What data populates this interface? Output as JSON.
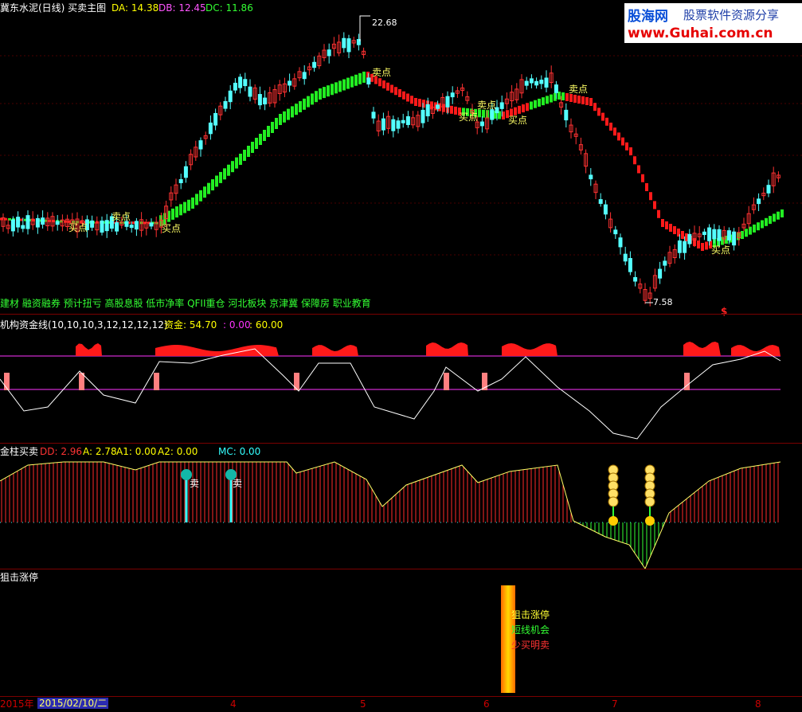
{
  "header": {
    "title": "冀东水泥(日线) 买卖主图",
    "da": "DA: 14.38",
    "db": "DB: 12.45",
    "dc": "DC: 11.86"
  },
  "logo": {
    "cn": "股海网",
    "sub": "股票软件资源分享",
    "url": "www.Guhai.com.cn"
  },
  "main_chart": {
    "high_label": "22.68",
    "low_label": "7.58",
    "signals": [
      {
        "id": "s1",
        "text": "买点"
      },
      {
        "id": "s2",
        "text": "卖点"
      },
      {
        "id": "s3",
        "text": "买点"
      },
      {
        "id": "s4",
        "text": "卖点"
      },
      {
        "id": "s5",
        "text": "卖点"
      },
      {
        "id": "s6",
        "text": "买点"
      },
      {
        "id": "s7",
        "text": "买点"
      },
      {
        "id": "s8",
        "text": "卖点"
      },
      {
        "id": "s9",
        "text": "买点"
      }
    ],
    "sectors": "建材 融资融券 预计扭亏 高股息股 低市净率 QFII重仓 河北板块 京津冀 保障房 职业教育",
    "dollar_mark": "$"
  },
  "panel2": {
    "title": "机构资金线(10,10,10,3,12,12,12,12)",
    "fund_label": "资金: 54.70",
    "v2": ": 0.00",
    "v3": ": 60.00"
  },
  "panel3": {
    "title": "金柱买卖",
    "dd": "DD: 2.96",
    "a": "A: 2.78",
    "a1": "A1: 0.00",
    "a2": "A2: 0.00",
    "mc": "MC: 0.00",
    "sell1": "卖",
    "sell2": "卖"
  },
  "panel4": {
    "title": "狙击涨停",
    "line1": "狙击涨停",
    "line2": "短线机会",
    "line3": "少买明卖"
  },
  "xaxis": {
    "year": "2015年",
    "date": "2015/02/10/二",
    "ticks": [
      "4",
      "5",
      "6",
      "7",
      "8"
    ]
  },
  "colors": {
    "up": "#ff3232",
    "down": "#54ffff",
    "green": "#22ee22",
    "red": "#ff1a1a",
    "yellow": "#ffff00",
    "magenta": "#ff00ff"
  }
}
